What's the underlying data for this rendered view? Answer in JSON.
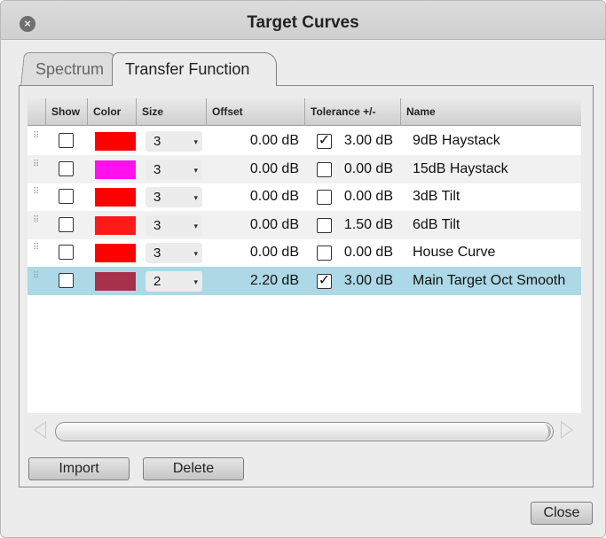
{
  "window": {
    "title": "Target Curves"
  },
  "tabs": [
    {
      "label": "Spectrum",
      "active": false
    },
    {
      "label": "Transfer Function",
      "active": true
    }
  ],
  "table": {
    "headers": [
      "",
      "Show",
      "Color",
      "Size",
      "Offset",
      "Tolerance +/-",
      "Name"
    ],
    "rows": [
      {
        "show": false,
        "color": "#ff0000",
        "size": "3",
        "offset": "0.00 dB",
        "tol_checked": true,
        "tolerance": "3.00 dB",
        "name": "9dB Haystack"
      },
      {
        "show": false,
        "color": "#ff11ee",
        "size": "3",
        "offset": "0.00 dB",
        "tol_checked": false,
        "tolerance": "0.00 dB",
        "name": "15dB Haystack"
      },
      {
        "show": false,
        "color": "#ff0000",
        "size": "3",
        "offset": "0.00 dB",
        "tol_checked": false,
        "tolerance": "0.00 dB",
        "name": "3dB Tilt"
      },
      {
        "show": false,
        "color": "#ff1a1a",
        "size": "3",
        "offset": "0.00 dB",
        "tol_checked": false,
        "tolerance": "1.50 dB",
        "name": "6dB Tilt"
      },
      {
        "show": false,
        "color": "#ff0000",
        "size": "3",
        "offset": "0.00 dB",
        "tol_checked": false,
        "tolerance": "0.00 dB",
        "name": "House Curve"
      },
      {
        "show": false,
        "color": "#a8304a",
        "size": "2",
        "offset": "2.20 dB",
        "tol_checked": true,
        "tolerance": "3.00 dB",
        "name": "Main Target Oct Smooth",
        "selected": true
      }
    ]
  },
  "buttons": {
    "import": "Import",
    "delete": "Delete",
    "close": "Close"
  },
  "glyphs": {
    "close_x": "×",
    "check": "✓",
    "grip": "⠿",
    "dropdown": "▾"
  },
  "icons": [
    "close-circle-icon",
    "grip-icon",
    "dropdown-arrow-icon",
    "scroll-left-icon",
    "scroll-right-icon"
  ]
}
